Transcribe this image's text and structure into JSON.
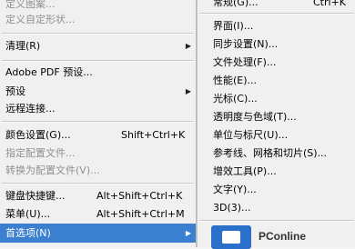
{
  "left_menu": {
    "items": [
      {
        "label": "定义图案...",
        "shortcut": "",
        "disabled": true
      },
      {
        "label": "定义自定形状...",
        "shortcut": "",
        "disabled": true
      },
      {
        "label": "清理(R)",
        "shortcut": "",
        "has_submenu": true
      },
      {
        "label": "Adobe PDF 预设...",
        "shortcut": ""
      },
      {
        "label": "预设",
        "shortcut": "",
        "has_submenu": true
      },
      {
        "label": "远程连接...",
        "shortcut": ""
      },
      {
        "label": "颜色设置(G)...",
        "shortcut": "Shift+Ctrl+K"
      },
      {
        "label": "指定配置文件...",
        "shortcut": "",
        "disabled": true
      },
      {
        "label": "转换为配置文件(V)...",
        "shortcut": "",
        "disabled": true
      },
      {
        "label": "键盘快捷键...",
        "shortcut": "Alt+Shift+Ctrl+K"
      },
      {
        "label": "菜单(U)...",
        "shortcut": "Alt+Shift+Ctrl+M"
      },
      {
        "label": "首选项(N)",
        "shortcut": "",
        "has_submenu": true,
        "selected": true
      }
    ]
  },
  "submenu": {
    "items": [
      {
        "label": "常规(G)...",
        "shortcut": "Ctrl+K"
      },
      {
        "label": "界面(I)..."
      },
      {
        "label": "同步设置(N)..."
      },
      {
        "label": "文件处理(F)..."
      },
      {
        "label": "性能(E)..."
      },
      {
        "label": "光标(C)..."
      },
      {
        "label": "透明度与色域(T)..."
      },
      {
        "label": "单位与标尺(U)..."
      },
      {
        "label": "参考线、网格和切片(S)..."
      },
      {
        "label": "增效工具(P)..."
      },
      {
        "label": "文字(Y)..."
      },
      {
        "label": "3D(3)..."
      }
    ]
  },
  "watermark": {
    "text": "PConline"
  },
  "colors": {
    "highlight": "#3a7fd0",
    "menu_bg": "#f0f0f0",
    "disabled_text": "#8f8f8f"
  }
}
